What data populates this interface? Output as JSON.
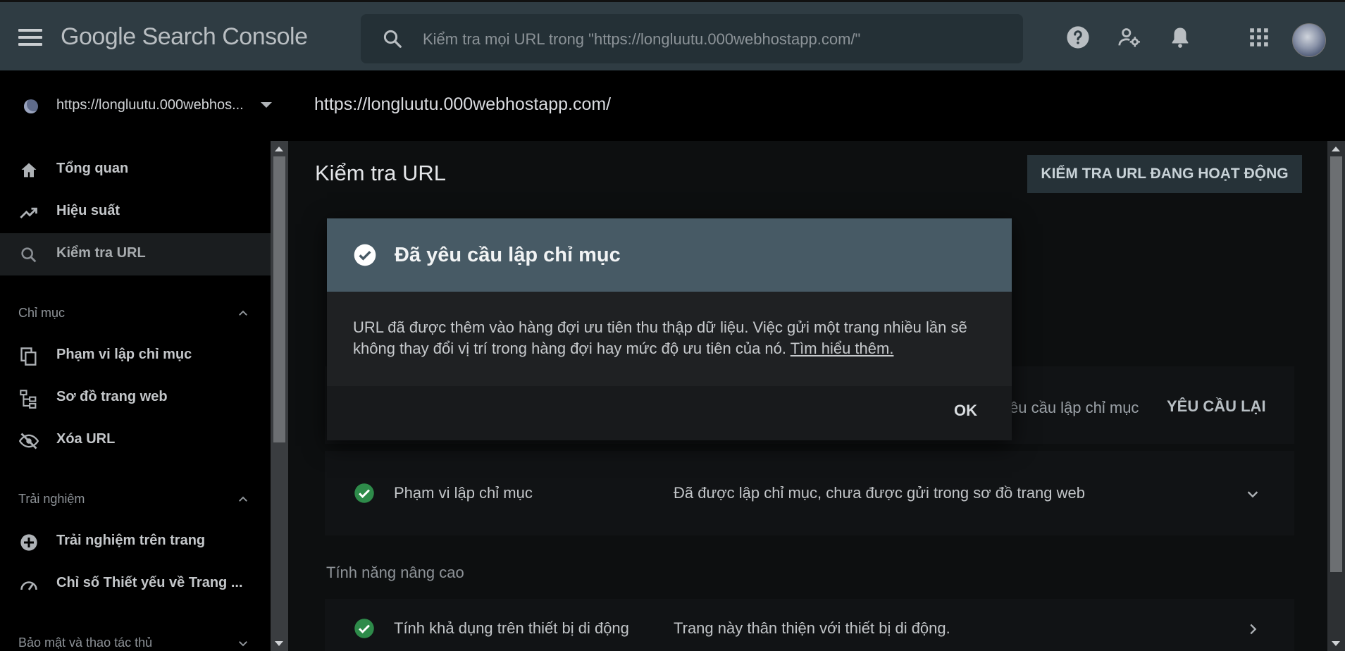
{
  "topbar": {
    "brand": "Google Search Console",
    "search_placeholder": "Kiểm tra mọi URL trong \"https://longluutu.000webhostapp.com/\""
  },
  "property": {
    "label": "https://longluutu.000webhos...",
    "url_header": "https://longluutu.000webhostapp.com/"
  },
  "sidebar": {
    "items_top": [
      {
        "label": "Tổng quan",
        "icon": "home-icon"
      },
      {
        "label": "Hiệu suất",
        "icon": "trending-up-icon"
      },
      {
        "label": "Kiểm tra URL",
        "icon": "search-icon",
        "active": true
      }
    ],
    "section_index": {
      "title": "Chỉ mục",
      "items": [
        {
          "label": "Phạm vi lập chỉ mục",
          "icon": "copy-icon"
        },
        {
          "label": "Sơ đồ trang web",
          "icon": "sitemap-icon"
        },
        {
          "label": "Xóa URL",
          "icon": "visibility-off-icon"
        }
      ]
    },
    "section_experience": {
      "title": "Trải nghiệm",
      "items": [
        {
          "label": "Trải nghiệm trên trang",
          "icon": "experience-icon"
        },
        {
          "label": "Chỉ số Thiết yếu về Trang ...",
          "icon": "speedometer-icon"
        }
      ]
    },
    "section_security": {
      "title": "Bảo mật và thao tác thủ"
    }
  },
  "main": {
    "title": "Kiểm tra URL",
    "live_test_button": "KIỂM TRA URL ĐANG HOẠT ĐỘNG",
    "request_label": "êu cầu lập chỉ mục",
    "request_again": "YÊU CẦU LẠI",
    "coverage": {
      "label": "Phạm vi lập chỉ mục",
      "value": "Đã được lập chỉ mục, chưa được gửi trong sơ đồ trang web"
    },
    "advanced_title": "Tính năng nâng cao",
    "mobile": {
      "label": "Tính khả dụng trên thiết bị di động",
      "value": "Trang này thân thiện với thiết bị di động."
    }
  },
  "dialog": {
    "title": "Đã yêu cầu lập chỉ mục",
    "body": "URL đã được thêm vào hàng đợi ưu tiên thu thập dữ liệu. Việc gửi một trang nhiều lần sẽ không thay đổi vị trí trong hàng đợi hay mức độ ưu tiên của nó.",
    "learn_more": "Tìm hiểu thêm.",
    "ok": "OK"
  },
  "colors": {
    "topbar": "#2f3c43",
    "dialog_header": "#475a65",
    "check_green": "#34a853"
  }
}
